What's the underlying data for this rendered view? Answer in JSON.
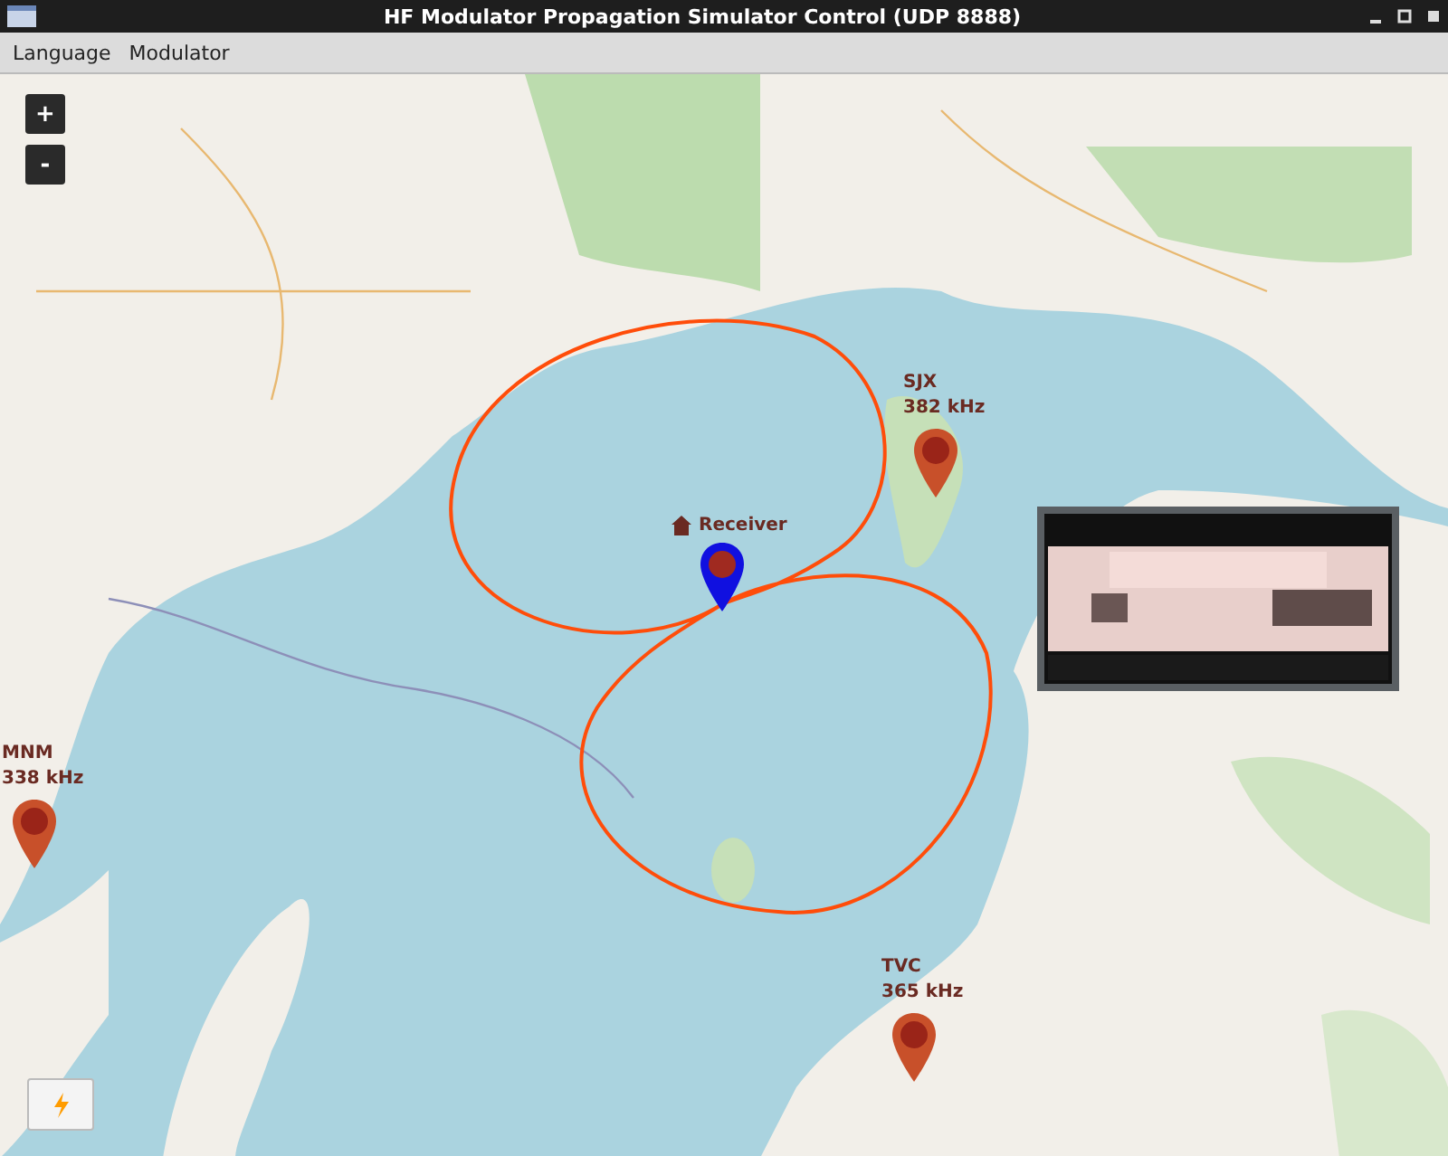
{
  "window": {
    "title": "HF Modulator Propagation Simulator Control (UDP 8888)"
  },
  "menu": [
    {
      "label": "Language"
    },
    {
      "label": "Modulator"
    }
  ],
  "map": {
    "zoom_controls": [
      "+",
      "-"
    ],
    "markers": [
      {
        "kind": "receiver",
        "name": "Receiver"
      },
      {
        "kind": "station",
        "name": "SJX",
        "frequency": "382 kHz"
      },
      {
        "kind": "station",
        "name": "MNM",
        "frequency": "338 kHz"
      },
      {
        "kind": "station",
        "name": "TVC",
        "frequency": "365 kHz"
      }
    ]
  }
}
